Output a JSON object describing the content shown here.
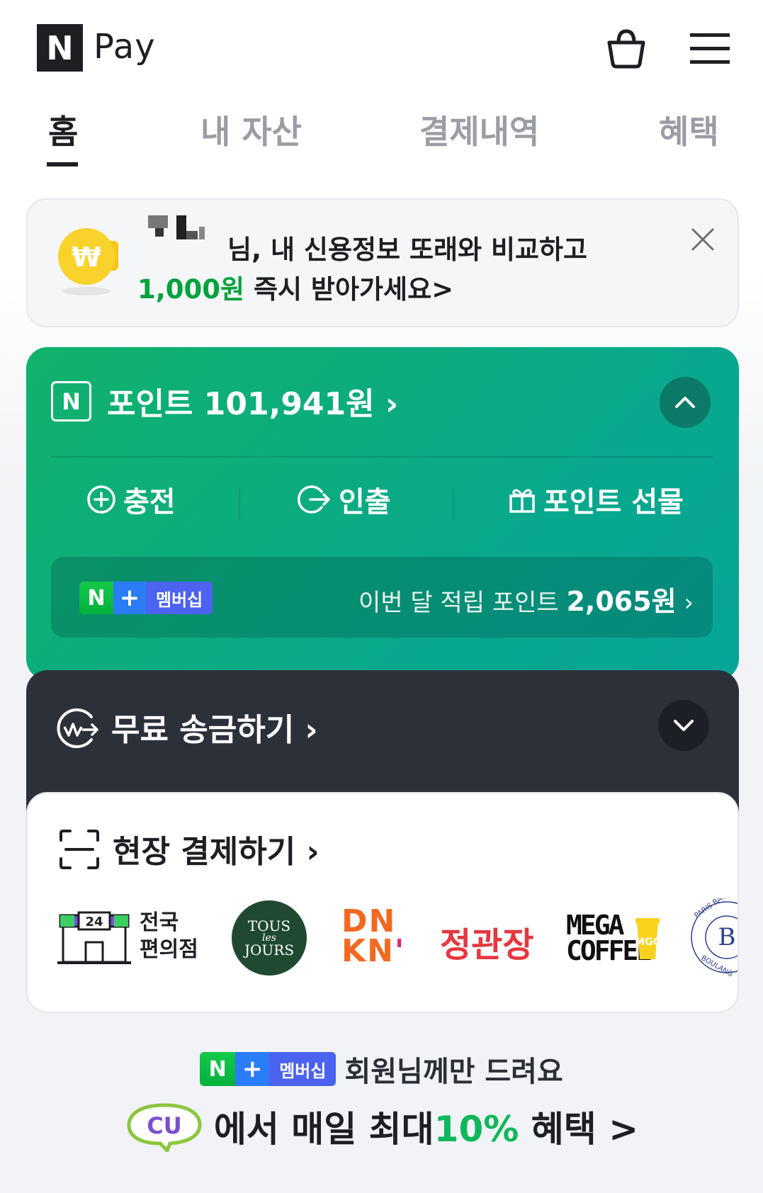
{
  "header": {
    "logo_letter": "N",
    "logo_text": "Pay"
  },
  "tabs": [
    {
      "label": "홈",
      "active": true
    },
    {
      "label": "내 자산",
      "active": false
    },
    {
      "label": "결제내역",
      "active": false
    },
    {
      "label": "혜택",
      "active": false
    }
  ],
  "banner": {
    "line1_suffix": "님, 내 신용정보 또래와 비교하고",
    "amount": "1,000원",
    "line2_rest": " 즉시 받아가세요",
    "chevron": ">"
  },
  "point_card": {
    "n_label": "N",
    "title": "포인트 101,941원",
    "chevron": "›",
    "actions": [
      {
        "label": "충전"
      },
      {
        "label": "인출"
      },
      {
        "label": "포인트 선물"
      }
    ],
    "membership": {
      "badge_n": "N",
      "badge_plus": "+",
      "badge_text": "멤버십",
      "text": "이번 달 적립 포인트",
      "amount": "2,065원",
      "chevron": "›"
    }
  },
  "transfer": {
    "title": "무료 송금하기",
    "chevron": "›"
  },
  "onsite_pay": {
    "title": "현장 결제하기",
    "chevron": "›",
    "brands": {
      "convenience": {
        "badge": "24",
        "line1": "전국",
        "line2": "편의점"
      },
      "tous_les_jours": {
        "line1": "TOUS",
        "line2": "les",
        "line3": "JOURS"
      },
      "dunkin": {
        "line1": "DN",
        "line2": "KN",
        "dot": "'"
      },
      "jeonggwanjang": "정관장",
      "mega_coffee": {
        "line1": "MEGA",
        "line2": "COFFEE"
      },
      "paris_baguette": {
        "arc_top": "PARIS BAG",
        "arc_bottom": "BOULANG"
      }
    }
  },
  "promo": {
    "badge_n": "N",
    "badge_plus": "+",
    "badge_text": "멤버십",
    "line1": "회원님께만 드려요",
    "cu_label": "CU",
    "line2_prefix": "에서 매일 최대",
    "line2_highlight": "10%",
    "line2_suffix": " 혜택",
    "chevron": ">"
  },
  "colors": {
    "brand_green": "#11b26b",
    "dark_card": "#2c3139",
    "accent_green_text": "#00a23c"
  }
}
